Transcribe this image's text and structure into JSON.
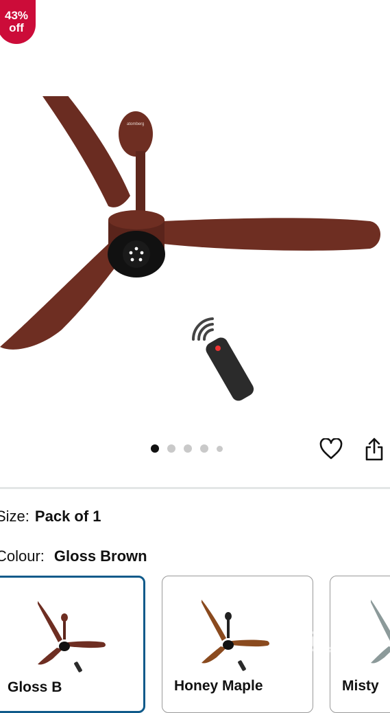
{
  "badge": {
    "percent": "43%",
    "suffix": "off"
  },
  "carousel": {
    "dot_count": 5,
    "active_index": 0
  },
  "product_image": {
    "brand_label": "atomberg"
  },
  "actions": {
    "wishlist_icon": "heart-icon",
    "share_icon": "share-icon"
  },
  "variations": {
    "size_label": "Size:",
    "size_value": "Pack of 1",
    "colour_label": "Colour:",
    "colour_value": "Gloss Brown"
  },
  "swatches": [
    {
      "name": "Gloss Brown",
      "visible_text": "Gloss B",
      "selected": true,
      "blade_color": "#6e2e22"
    },
    {
      "name": "Honey Maple",
      "visible_text": "Honey Maple",
      "selected": false,
      "blade_color": "#8a4a1e"
    },
    {
      "name": "Misty",
      "visible_text": "Misty",
      "selected": false,
      "blade_color": "#8c9a9a"
    }
  ],
  "watermark": {
    "text": "OLX",
    "sub": "INDIA"
  },
  "colors": {
    "badge": "#cc0c39",
    "selected_border": "#0f5a8a",
    "fan_brown": "#6e2e22"
  }
}
